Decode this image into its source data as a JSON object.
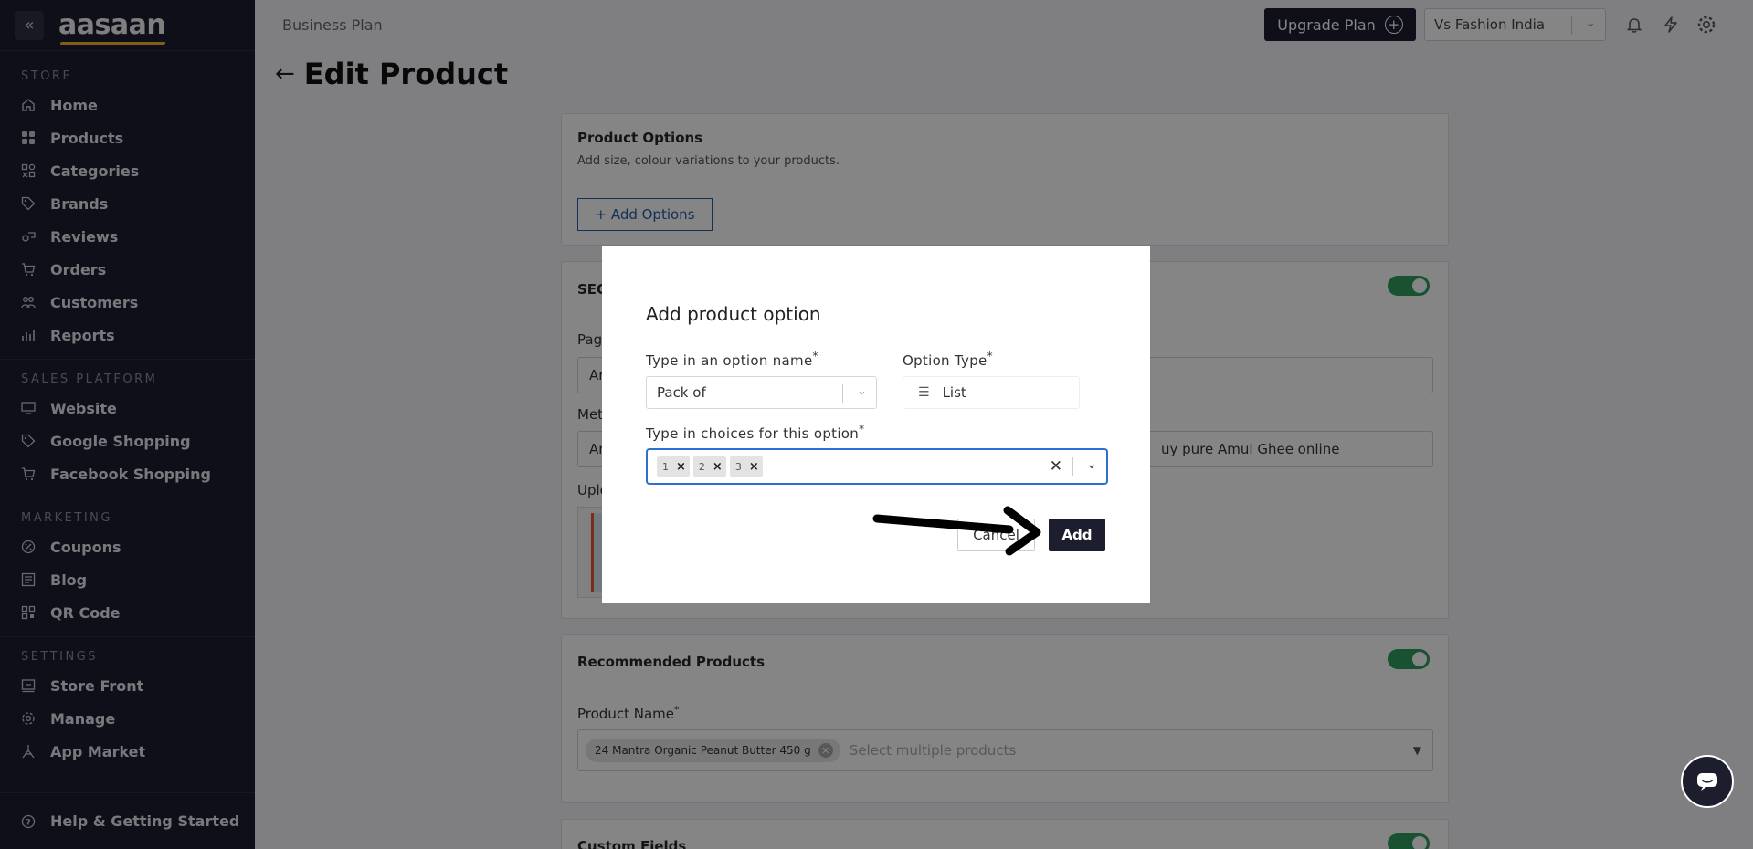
{
  "brand": {
    "logo_text": "aasaan"
  },
  "sidebar": {
    "sections": [
      {
        "title": "STORE",
        "items": [
          {
            "label": "Home",
            "icon": "home-icon"
          },
          {
            "label": "Products",
            "icon": "products-icon"
          },
          {
            "label": "Categories",
            "icon": "categories-icon"
          },
          {
            "label": "Brands",
            "icon": "tag-icon"
          },
          {
            "label": "Reviews",
            "icon": "reviews-icon"
          },
          {
            "label": "Orders",
            "icon": "cart-icon"
          },
          {
            "label": "Customers",
            "icon": "customers-icon"
          },
          {
            "label": "Reports",
            "icon": "reports-icon"
          }
        ]
      },
      {
        "title": "SALES PLATFORM",
        "items": [
          {
            "label": "Website",
            "icon": "monitor-icon"
          },
          {
            "label": "Google Shopping",
            "icon": "tag-icon"
          },
          {
            "label": "Facebook Shopping",
            "icon": "cart-icon"
          }
        ]
      },
      {
        "title": "MARKETING",
        "items": [
          {
            "label": "Coupons",
            "icon": "coupon-icon"
          },
          {
            "label": "Blog",
            "icon": "blog-icon"
          },
          {
            "label": "QR Code",
            "icon": "qr-icon"
          }
        ]
      },
      {
        "title": "SETTINGS",
        "items": [
          {
            "label": "Store Front",
            "icon": "storefront-icon"
          },
          {
            "label": "Manage",
            "icon": "gear-icon"
          },
          {
            "label": "App Market",
            "icon": "app-market-icon"
          }
        ]
      }
    ],
    "help_label": "Help & Getting Started"
  },
  "topbar": {
    "plan_label": "Business Plan",
    "upgrade_label": "Upgrade Plan",
    "store_name": "Vs Fashion India"
  },
  "page": {
    "title": "Edit Product"
  },
  "product_options": {
    "title": "Product Options",
    "subtitle": "Add size, colour variations to your products.",
    "add_button": "+ Add Options"
  },
  "seo": {
    "title_partial": "SEO",
    "page_label_partial": "Pag",
    "page_value_partial": "Ar",
    "meta_label_partial": "Met",
    "meta_value_partial": "Ar",
    "meta_value_tail": "uy pure Amul Ghee online",
    "upload_label_partial": "Uplo"
  },
  "recommended": {
    "title": "Recommended Products",
    "field_label": "Product Name",
    "selected_chip": "24 Mantra Organic Peanut Butter 450 g",
    "placeholder": "Select multiple products"
  },
  "custom_fields": {
    "title": "Custom Fields"
  },
  "modal": {
    "title": "Add product option",
    "name_label": "Type in an option name",
    "name_value": "Pack of",
    "type_label": "Option Type",
    "type_value": "List",
    "choices_label": "Type in choices for this option",
    "choices": [
      "1",
      "2",
      "3"
    ],
    "cancel_label": "Cancel",
    "add_label": "Add"
  },
  "colors": {
    "sidebar_bg": "#1c1e2e",
    "toggle_on": "#2f9e5f",
    "link_blue": "#2a5ca8",
    "focus_blue": "#2f6fd1"
  }
}
